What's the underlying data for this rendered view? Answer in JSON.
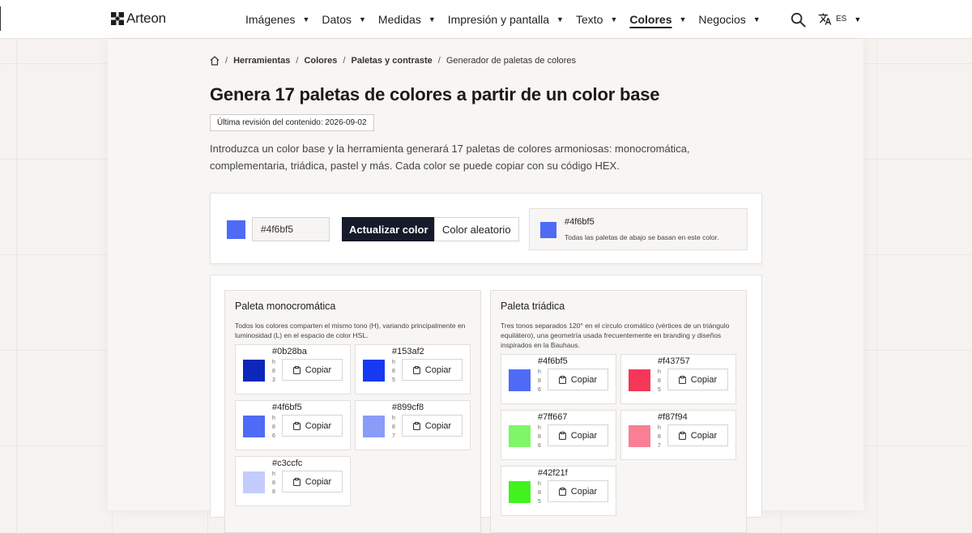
{
  "brand": {
    "name": "Arteon"
  },
  "nav": [
    {
      "label": "Imágenes",
      "active": false
    },
    {
      "label": "Datos",
      "active": false
    },
    {
      "label": "Medidas",
      "active": false
    },
    {
      "label": "Impresión y pantalla",
      "active": false
    },
    {
      "label": "Texto",
      "active": false
    },
    {
      "label": "Colores",
      "active": true
    },
    {
      "label": "Negocios",
      "active": false
    }
  ],
  "header": {
    "search_icon": "search-icon",
    "language": "ES",
    "language_icon": "translate-icon"
  },
  "breadcrumb": {
    "home_icon": "home-icon",
    "items": [
      "Herramientas",
      "Colores",
      "Paletas y contraste"
    ],
    "current": "Generador de paletas de colores"
  },
  "page": {
    "title": "Genera 17 paletas de colores a partir de un color base",
    "revision": "Última revisión del contenido: 2026-09-02",
    "intro": "Introduzca un color base y la herramienta generará 17 paletas de colores armoniosas: monocromática, complementaria, triádica, pastel y más. Cada color se puede copiar con su código HEX."
  },
  "controls": {
    "base_color": "#4f6bf5",
    "input_value": "#4f6bf5",
    "update_label": "Actualizar color",
    "random_label": "Color aleatorio",
    "current_hex": "#4f6bf5",
    "current_note": "Todas las paletas de abajo se basan en este color."
  },
  "copy_label": "Copiar",
  "palettes": [
    {
      "title": "Paleta monocromática",
      "description": "Todos los colores comparten el mismo tono (H), variando principalmente en luminosidad (L) en el espacio de color HSL.",
      "colors": [
        {
          "hex": "#0b28ba",
          "meta": [
            "h",
            "8",
            "3"
          ]
        },
        {
          "hex": "#153af2",
          "meta": [
            "h",
            "8",
            "5"
          ]
        },
        {
          "hex": "#4f6bf5",
          "meta": [
            "h",
            "8",
            "6"
          ]
        },
        {
          "hex": "#899cf8",
          "meta": [
            "h",
            "8",
            "7"
          ]
        },
        {
          "hex": "#c3ccfc",
          "meta": [
            "h",
            "8",
            "8"
          ]
        }
      ]
    },
    {
      "title": "Paleta triádica",
      "description": "Tres tonos separados 120° en el círculo cromático (vértices de un triángulo equilátero), una geometría usada frecuentemente en branding y diseños inspirados en la Bauhaus.",
      "colors": [
        {
          "hex": "#4f6bf5",
          "meta": [
            "h",
            "8",
            "6"
          ]
        },
        {
          "hex": "#f43757",
          "meta": [
            "h",
            "8",
            "5"
          ]
        },
        {
          "hex": "#7ff667",
          "meta": [
            "h",
            "8",
            "6"
          ]
        },
        {
          "hex": "#f87f94",
          "meta": [
            "h",
            "8",
            "7"
          ]
        },
        {
          "hex": "#42f21f",
          "meta": [
            "h",
            "8",
            "5"
          ]
        }
      ]
    }
  ]
}
